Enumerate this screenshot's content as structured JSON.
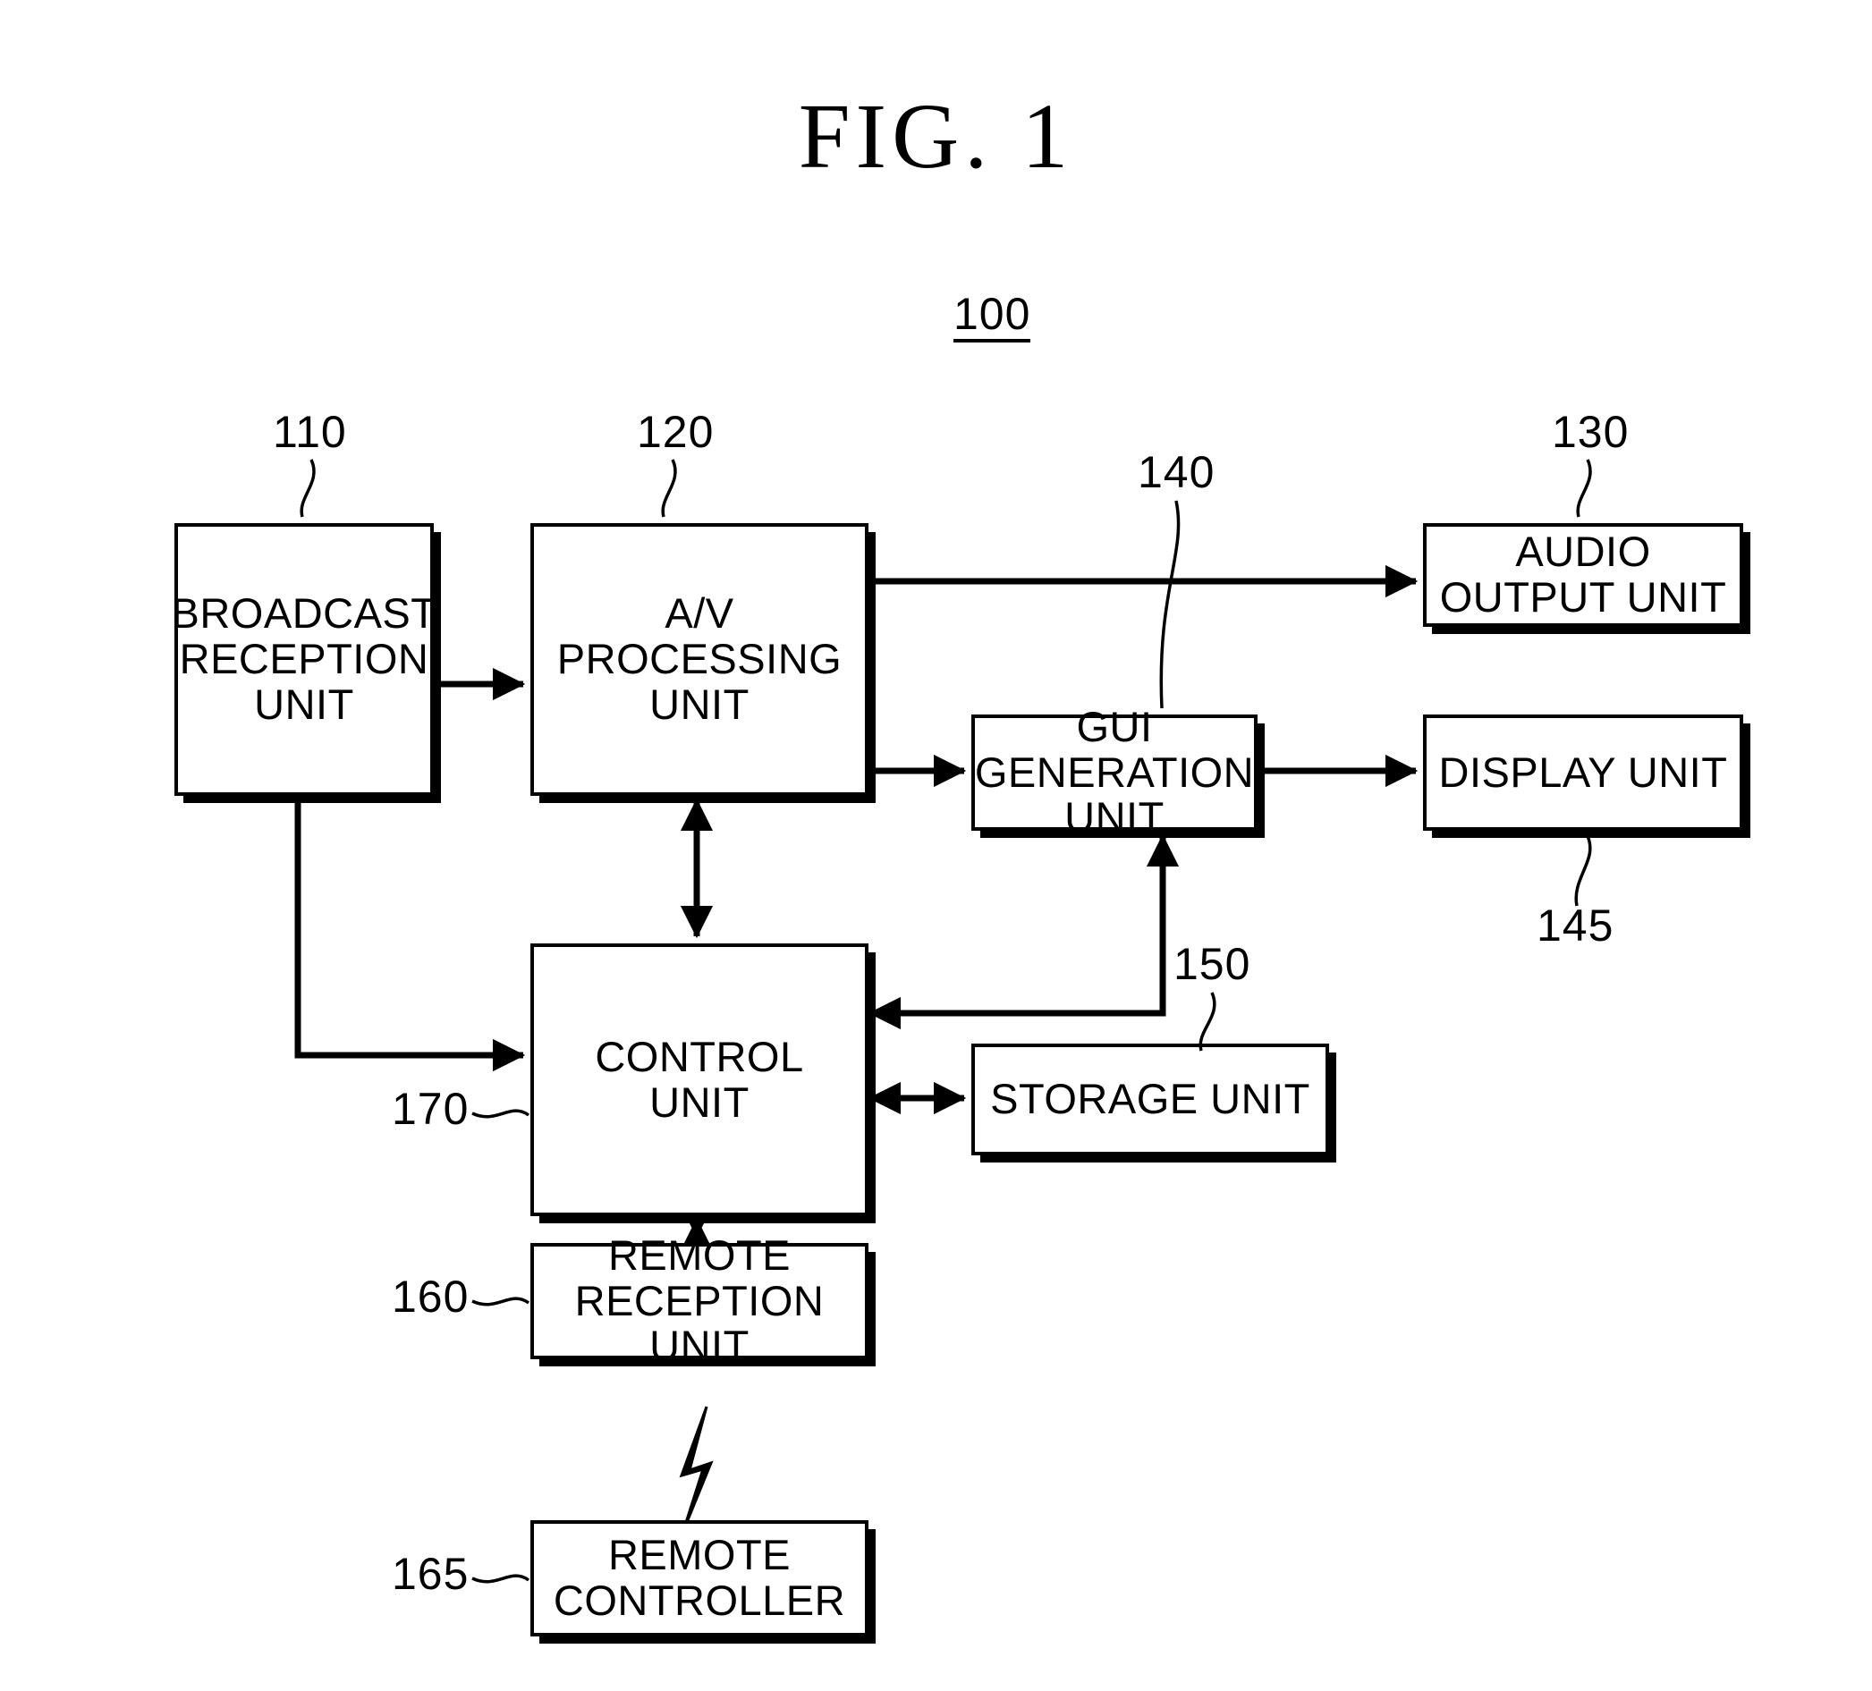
{
  "figure": {
    "title": "FIG.  1",
    "assembly_number": "100"
  },
  "blocks": [
    {
      "id": "broadcast-reception-unit",
      "label": "BROADCAST\nRECEPTION\nUNIT",
      "ref": "110"
    },
    {
      "id": "av-processing-unit",
      "label": "A/V\nPROCESSING\nUNIT",
      "ref": "120"
    },
    {
      "id": "audio-output-unit",
      "label": "AUDIO\nOUTPUT UNIT",
      "ref": "130"
    },
    {
      "id": "gui-generation-unit",
      "label": "GUI\nGENERATION UNIT",
      "ref": "140"
    },
    {
      "id": "display-unit",
      "label": "DISPLAY UNIT",
      "ref": "145"
    },
    {
      "id": "storage-unit",
      "label": "STORAGE UNIT",
      "ref": "150"
    },
    {
      "id": "control-unit",
      "label": "CONTROL\nUNIT",
      "ref": "170"
    },
    {
      "id": "remote-reception-unit",
      "label": "REMOTE\nRECEPTION UNIT",
      "ref": "160"
    },
    {
      "id": "remote-controller",
      "label": "REMOTE\nCONTROLLER",
      "ref": "165"
    }
  ],
  "refnums": {
    "r110": "110",
    "r120": "120",
    "r130": "130",
    "r140": "140",
    "r145": "145",
    "r150": "150",
    "r160": "160",
    "r165": "165",
    "r170": "170"
  },
  "connections": [
    {
      "from": "broadcast-reception-unit",
      "to": "av-processing-unit",
      "kind": "arrow",
      "direction": "right"
    },
    {
      "from": "av-processing-unit",
      "to": "audio-output-unit",
      "kind": "arrow",
      "direction": "right"
    },
    {
      "from": "av-processing-unit",
      "to": "gui-generation-unit",
      "kind": "arrow",
      "direction": "right"
    },
    {
      "from": "gui-generation-unit",
      "to": "display-unit",
      "kind": "arrow",
      "direction": "right"
    },
    {
      "from": "av-processing-unit",
      "to": "control-unit",
      "kind": "double-arrow",
      "direction": "vertical"
    },
    {
      "from": "control-unit",
      "to": "broadcast-reception-unit",
      "kind": "arrow",
      "direction": "up-left"
    },
    {
      "from": "control-unit",
      "to": "gui-generation-unit",
      "kind": "arrow",
      "direction": "up-right"
    },
    {
      "from": "control-unit",
      "to": "storage-unit",
      "kind": "double-arrow",
      "direction": "horizontal"
    },
    {
      "from": "control-unit",
      "to": "remote-reception-unit",
      "kind": "double-arrow",
      "direction": "vertical"
    },
    {
      "from": "remote-controller",
      "to": "remote-reception-unit",
      "kind": "wireless-bolt",
      "direction": "up"
    }
  ],
  "icons": {
    "wireless_bolt": "lightning-bolt-icon"
  },
  "colors": {
    "ink": "#000000",
    "paper": "#ffffff"
  }
}
